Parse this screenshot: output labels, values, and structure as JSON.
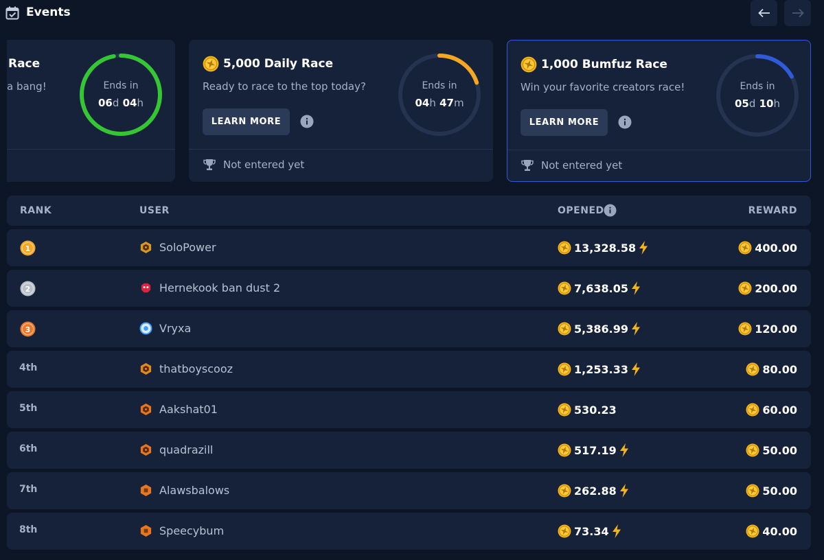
{
  "header": {
    "title": "Events"
  },
  "races": [
    {
      "title": "Race",
      "subtitle": "a bang!",
      "ends_label": "Ends in",
      "time": [
        {
          "n": "06",
          "u": "d"
        },
        {
          "n": "04",
          "u": "h"
        }
      ],
      "ring_color": "#35c634",
      "progress": 0.97
    },
    {
      "title": "5,000 Daily Race",
      "subtitle": "Ready to race to the top today?",
      "learn_more": "LEARN MORE",
      "status": "Not entered yet",
      "ends_label": "Ends in",
      "time": [
        {
          "n": "04",
          "u": "h"
        },
        {
          "n": "47",
          "u": "m"
        }
      ],
      "ring_color": "#f5a623",
      "progress": 0.2
    },
    {
      "title": "1,000 Bumfuz Race",
      "subtitle": "Win your favorite creators race!",
      "learn_more": "LEARN MORE",
      "status": "Not entered yet",
      "ends_label": "Ends in",
      "time": [
        {
          "n": "05",
          "u": "d"
        },
        {
          "n": "10",
          "u": "h"
        }
      ],
      "ring_color": "#2f5ad8",
      "progress": 0.17
    }
  ],
  "table": {
    "headers": {
      "rank": "RANK",
      "user": "USER",
      "opened": "OPENED",
      "reward": "REWARD"
    },
    "rows": [
      {
        "rank": "1",
        "user": "SoloPower",
        "opened": "13,328.58",
        "boost": true,
        "reward": "400.00"
      },
      {
        "rank": "2",
        "user": "Hernekook ban dust 2",
        "opened": "7,638.05",
        "boost": true,
        "reward": "200.00"
      },
      {
        "rank": "3",
        "user": "Vryxa",
        "opened": "5,386.99",
        "boost": true,
        "reward": "120.00"
      },
      {
        "rank": "4th",
        "user": "thatboyscooz",
        "opened": "1,253.33",
        "boost": true,
        "reward": "80.00"
      },
      {
        "rank": "5th",
        "user": "Aakshat01",
        "opened": "530.23",
        "boost": false,
        "reward": "60.00"
      },
      {
        "rank": "6th",
        "user": "quadrazill",
        "opened": "517.19",
        "boost": true,
        "reward": "50.00"
      },
      {
        "rank": "7th",
        "user": "Alawsbalows",
        "opened": "262.88",
        "boost": true,
        "reward": "50.00"
      },
      {
        "rank": "8th",
        "user": "Speecybum",
        "opened": "73.34",
        "boost": true,
        "reward": "40.00"
      }
    ]
  }
}
